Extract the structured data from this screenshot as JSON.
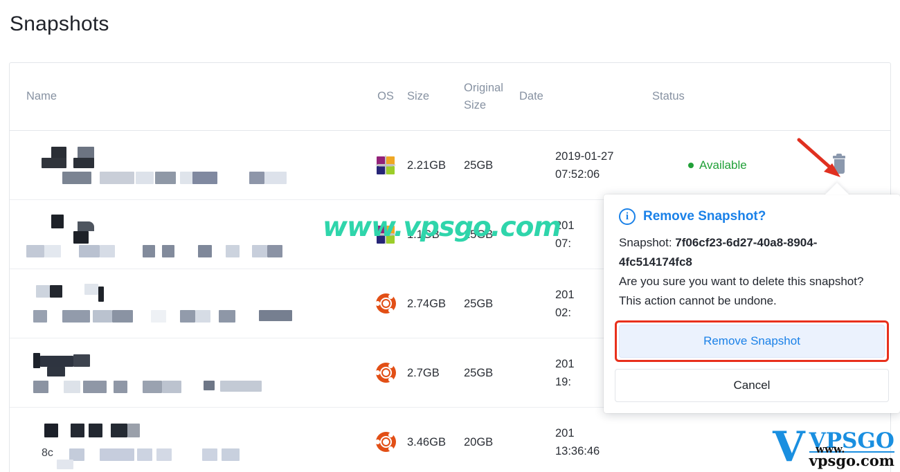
{
  "page": {
    "title": "Snapshots"
  },
  "table": {
    "headers": {
      "name": "Name",
      "os": "OS",
      "size": "Size",
      "original_size_line1": "Original",
      "original_size_line2": "Size",
      "date": "Date",
      "status": "Status"
    },
    "rows": [
      {
        "name": "",
        "os_icon": "centos-icon",
        "size": "2.21GB",
        "original_size": "25GB",
        "date": "2019-01-27\n07:52:06",
        "status": "Available",
        "status_color": "#21a038",
        "action_icon": "trash-icon"
      },
      {
        "name": "",
        "os_icon": "centos-icon",
        "size": "1.1GB",
        "original_size": "25GB",
        "date": "201\n07:",
        "status": "",
        "status_color": "#21a038",
        "action_icon": ""
      },
      {
        "name": "",
        "os_icon": "ubuntu-icon",
        "size": "2.74GB",
        "original_size": "25GB",
        "date": "201\n02:",
        "status": "",
        "status_color": "#21a038",
        "action_icon": ""
      },
      {
        "name": "",
        "os_icon": "ubuntu-icon",
        "size": "2.7GB",
        "original_size": "25GB",
        "date": "201\n19:",
        "status": "",
        "status_color": "#21a038",
        "action_icon": ""
      },
      {
        "name": "8c",
        "os_icon": "ubuntu-icon",
        "size": "3.46GB",
        "original_size": "20GB",
        "date": "201\n13:36:46",
        "status": "",
        "status_color": "#21a038",
        "action_icon": ""
      }
    ]
  },
  "dialog": {
    "icon": "info-circle-icon",
    "title": "Remove Snapshot?",
    "snapshot_label": "Snapshot: ",
    "snapshot_id": "7f06cf23-6d27-40a8-8904-4fc514174fc8",
    "confirm_text": "Are you sure you want to delete this snapshot? This action cannot be undone.",
    "primary_button": "Remove Snapshot",
    "secondary_button": "Cancel",
    "highlight_color": "#e8301c",
    "accent_color": "#1a81e8"
  },
  "watermarks": {
    "center_text": "www.vpsgo.com",
    "center_color": "#2fd5ab",
    "logo_letter": "V",
    "logo_main": "VPSGO",
    "logo_sub": "vpsgo.com",
    "logo_www": "www.",
    "logo_color": "#1a8fe0"
  }
}
